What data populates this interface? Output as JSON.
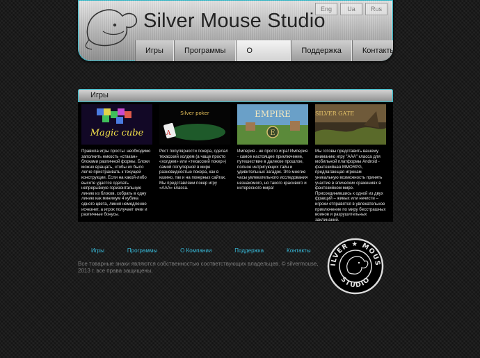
{
  "header": {
    "title": "Silver Mouse Studio",
    "languages": [
      "Eng",
      "Ua",
      "Rus"
    ]
  },
  "nav": [
    "Игры",
    "Программы",
    "О компании",
    "Поддержка",
    "Контакты"
  ],
  "nav_active": "О компании",
  "section": {
    "title": "Игры"
  },
  "cards": [
    {
      "thumb_title": "Magic cube",
      "text": "Правила игры просты: необходимо заполнить емкость «стакан» блоками различной формы. Блоки можно вращать, чтобы их было легче пристраивать к текущей конструкции. Если на какой-либо высоте удастся сделать непрерывную горизонтальную линию из блоков, собрать в одну линию как минимум 4 кубика одного цвета, линия немедленно исчезнет, а игрок получает очки и различные бонусы."
    },
    {
      "thumb_title": "Silver poker",
      "text": "Рост популярности покера, сделал техасский холдем (а чаще просто «холдем» или «техасский покер») самой популярной в мире разновидностью покера, как в казино, так и на покерных сайтах. Мы представляем покер игру «AAA» класса."
    },
    {
      "thumb_title": "EMPIRE",
      "text": "Империя - не просто игра! Империя - самое настоящее приключение, путешествие в далекое прошлое, полное интригующих тайн и удивительных загадок. Это многие часы увлекательного исследования незнакомого, но такого красивого и интересного мира!"
    },
    {
      "thumb_title": "SILVER GATE",
      "text": "Мы готовы представить вашему вниманию игру \"AAA\" класса для мобильной платформы Android - фэнтезийная MMORPG, предлагающая игрокам уникальную возможность принять участие в эпических сражениях в фэнтезийном мире. Присоединившись к одной из двух фракций – живых или нечисти – игроки отправятся в увлекательное приключение по миру бесстрашных воинов и разрушительных заклинаний."
    }
  ],
  "footer": {
    "nav": [
      "Игры",
      "Программы",
      "О Компании",
      "Поддержка",
      "Контакты"
    ],
    "copyright": "Все товарные знаки являются собственностью соответствующих владельцев. © silvermouse, 2013 г. все права защищены."
  },
  "colors": {
    "accent": "#2fb9c9",
    "link": "#37b9d8",
    "background": "#141414"
  }
}
